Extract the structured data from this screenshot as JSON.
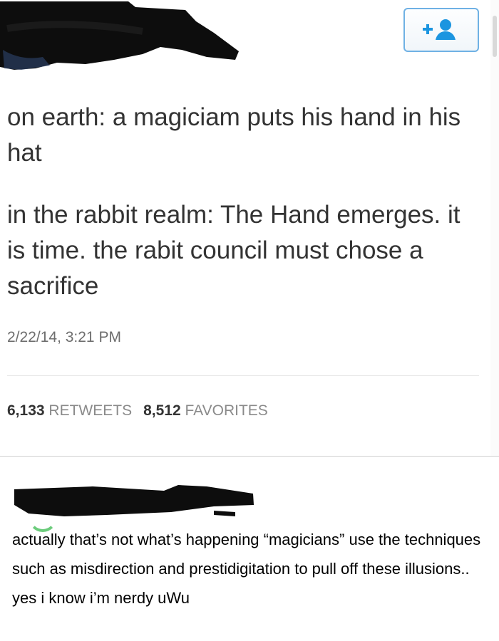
{
  "tweet": {
    "follow_button_icon": "add-user-icon",
    "follow_button_color": "#1b95e0",
    "paragraph_1": "on earth: a magiciam puts his hand in his hat",
    "paragraph_2": "in the rabbit realm: The Hand emerges. it is time. the rabit council must chose a sacrifice",
    "timestamp": "2/22/14, 3:21 PM",
    "retweets_count": "6,133",
    "retweets_label": "RETWEETS",
    "favorites_count": "8,512",
    "favorites_label": "FAVORITES"
  },
  "reply": {
    "text": "actually that’s not what’s happening “magicians” use the techniques such as misdirection and prestidigitation to pull off these illusions.. yes i know i’m nerdy uWu"
  }
}
